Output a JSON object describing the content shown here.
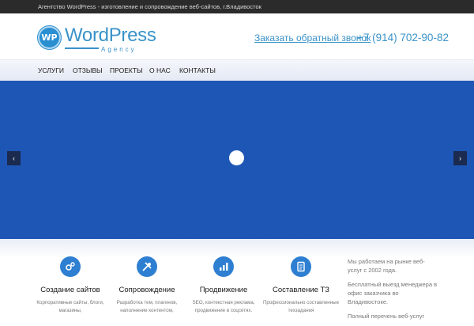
{
  "topbar": {
    "text": "Агентство WordPress - изготовление и сопровождение веб-сайтов, г.Владивосток"
  },
  "header": {
    "logo_badge": "WP",
    "logo_word": "WordPress",
    "logo_sub": "Agency",
    "callback_link": "Заказать обратный звонок",
    "phone": "+7 (914) 702-90-82"
  },
  "nav": {
    "items": [
      {
        "label": "УСЛУГИ"
      },
      {
        "label": "ОТЗЫВЫ"
      },
      {
        "label": "ПРОЕКТЫ"
      },
      {
        "label": "О НАС"
      },
      {
        "label": "КОНТАКТЫ"
      }
    ]
  },
  "slider": {
    "prev_icon": "chevron-left-icon",
    "next_icon": "chevron-right-icon",
    "prev_glyph": "‹",
    "next_glyph": "›",
    "slide_color": "#1e56b6"
  },
  "services": [
    {
      "icon": "gears-icon",
      "title": "Создание сайтов",
      "desc": "Корпоративные сайты, блоги, магазины,"
    },
    {
      "icon": "tools-icon",
      "title": "Сопровождение",
      "desc": "Разработка тем, плагинов, наполнение контентом,"
    },
    {
      "icon": "bar-chart-icon",
      "title": "Продвижение",
      "desc": "SEO, контекстная реклама, продвижение в соцсетях."
    },
    {
      "icon": "document-icon",
      "title": "Составление ТЗ",
      "desc": "Профессионально составленные техзадания"
    }
  ],
  "about": [
    {
      "text": "Мы работаем на рынке веб-услуг с 2002 года."
    },
    {
      "text": "Бесплатный выезд менеджера в офис заказчика во Владивостоке."
    },
    {
      "text": "Полный перечень веб-услуг"
    }
  ],
  "colors": {
    "accent": "#3a92c8",
    "slider_bg": "#1e56b6",
    "topbar_bg": "#2b2b2b",
    "icon_bg": "#2e7fd1"
  }
}
